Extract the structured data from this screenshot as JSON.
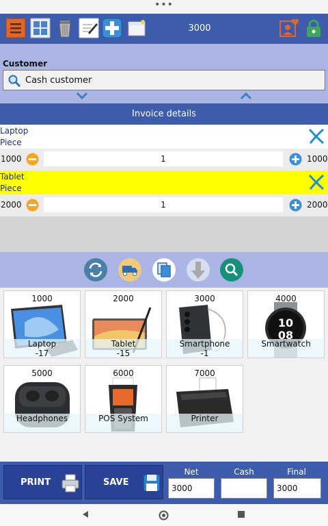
{
  "toolbar": {
    "total": "3000"
  },
  "customer": {
    "label": "Customer",
    "name": "Cash customer"
  },
  "invoice": {
    "header": "Invoice details",
    "items": [
      {
        "name": "Laptop",
        "unit": "Piece",
        "price": "1000",
        "qty": "1",
        "total": "1000"
      },
      {
        "name": "Tablet",
        "unit": "Piece",
        "price": "2000",
        "qty": "1",
        "total": "2000"
      }
    ]
  },
  "products": [
    {
      "price": "1000",
      "name": "Laptop",
      "stock": "-17"
    },
    {
      "price": "2000",
      "name": "Tablet",
      "stock": "-15"
    },
    {
      "price": "3000",
      "name": "Smartphone",
      "stock": "-1"
    },
    {
      "price": "4000",
      "name": "Smartwatch",
      "stock": ""
    },
    {
      "price": "5000",
      "name": "Headphones",
      "stock": ""
    },
    {
      "price": "6000",
      "name": "POS System",
      "stock": ""
    },
    {
      "price": "7000",
      "name": "Printer",
      "stock": ""
    }
  ],
  "footer": {
    "print_label": "PRINT",
    "save_label": "SAVE",
    "net_label": "Net",
    "net_value": "3000",
    "cash_label": "Cash",
    "cash_value": "",
    "final_label": "Final",
    "final_value": "3000"
  },
  "colors": {
    "primary": "#3d5cac",
    "light": "#aab5e3",
    "highlight": "#ffff00"
  },
  "icons": {
    "toolbar": [
      "menu-icon",
      "grid-icon",
      "trash-icon",
      "notes-icon",
      "add-icon",
      "folder-icon",
      "user-heart-icon",
      "lock-icon"
    ],
    "actions": [
      "refresh-icon",
      "truck-icon",
      "copy-icon",
      "download-icon",
      "search-icon"
    ]
  }
}
